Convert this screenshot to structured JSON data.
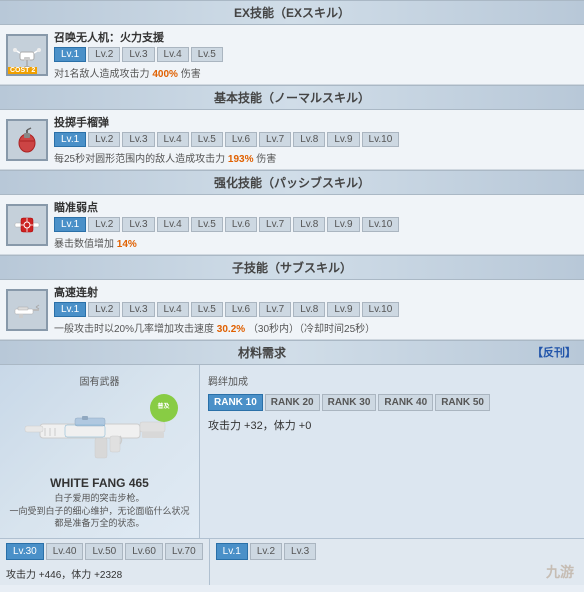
{
  "sections": {
    "ex_skill": {
      "header": "EX技能（EXスキル）",
      "name": "召唤无人机：火力支援",
      "cost": "COST 2",
      "levels": [
        "Lv.1",
        "Lv.2",
        "Lv.3",
        "Lv.4",
        "Lv.5"
      ],
      "active_level": 0,
      "desc_prefix": "对1名敌人造成攻击力",
      "desc_highlight": "400%",
      "desc_suffix": "伤害"
    },
    "basic_skill": {
      "header": "基本技能（ノーマルスキル）",
      "name": "投掷手榴弹",
      "levels": [
        "Lv.1",
        "Lv.2",
        "Lv.3",
        "Lv.4",
        "Lv.5",
        "Lv.6",
        "Lv.7",
        "Lv.8",
        "Lv.9",
        "Lv.10"
      ],
      "active_level": 0,
      "desc_prefix": "每25秒对圆形范围内的敌人造成攻击力",
      "desc_highlight": "193%",
      "desc_suffix": "伤害"
    },
    "enhance_skill": {
      "header": "强化技能（パッシブスキル）",
      "name": "瞄准弱点",
      "levels": [
        "Lv.1",
        "Lv.2",
        "Lv.3",
        "Lv.4",
        "Lv.5",
        "Lv.6",
        "Lv.7",
        "Lv.8",
        "Lv.9",
        "Lv.10"
      ],
      "active_level": 0,
      "desc_prefix": "暴击数值增加",
      "desc_highlight": "14%",
      "desc_suffix": ""
    },
    "sub_skill": {
      "header": "子技能（サブスキル）",
      "name": "高速连射",
      "levels": [
        "Lv.1",
        "Lv.2",
        "Lv.3",
        "Lv.4",
        "Lv.5",
        "Lv.6",
        "Lv.7",
        "Lv.8",
        "Lv.9",
        "Lv.10"
      ],
      "active_level": 0,
      "desc_prefix": "一般攻击时以20%几率增加攻击速度",
      "desc_highlight": "30.2%",
      "desc_suffix": "（30秒内）（冷却时间25秒）"
    }
  },
  "materials": {
    "header_left": "材料需求",
    "header_right": "【反刊】",
    "col_weapon": "固有武器",
    "col_bonus": "羁绊加成",
    "weapon": {
      "name": "WHITE FANG 465",
      "desc1": "白子爱用的突击步枪。",
      "desc2": "一向受到白子的细心维护，无论面临什么状况都是准备万全的状态。"
    },
    "badge_text": "普及",
    "ranks": [
      "RANK 10",
      "RANK 20",
      "RANK 30",
      "RANK 40",
      "RANK 50"
    ],
    "active_rank": 0,
    "bonus_text": "攻击力 +32，体力 +0"
  },
  "bottom": {
    "levels": [
      "Lv.30",
      "Lv.40",
      "Lv.50",
      "Lv.60",
      "Lv.70"
    ],
    "active_level": 0,
    "stat": "攻击力 +446，体力 +2328",
    "right_levels": [
      "Lv.1",
      "Lv.2",
      "Lv.3"
    ],
    "right_active": 0
  }
}
